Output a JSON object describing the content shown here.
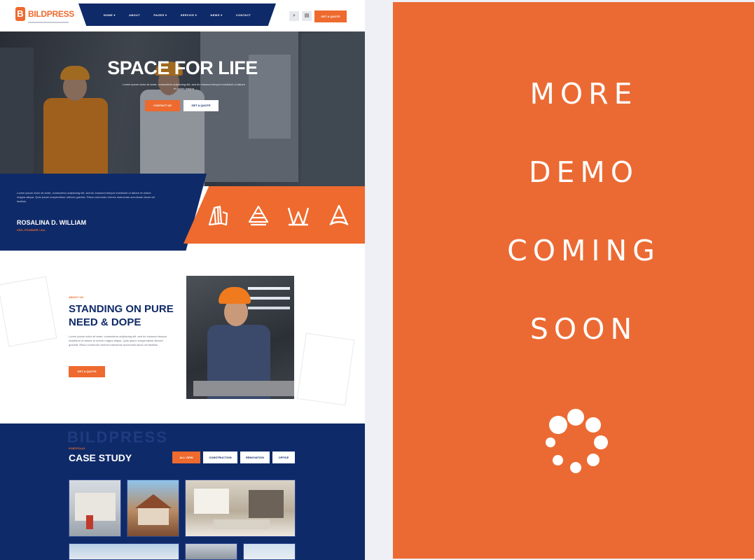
{
  "header": {
    "logo_letter": "B",
    "logo_text": "BILDPRESS",
    "nav": [
      "HOME ▾",
      "ABOUT",
      "PAGES ▾",
      "SERVICE ▾",
      "NEWS ▾",
      "CONTACT"
    ],
    "search_icon": "search-icon",
    "cart_icon": "cart-icon",
    "cta_label": "GET A QUOTE"
  },
  "hero": {
    "title": "SPACE FOR LIFE",
    "text": "Lorem ipsum dolor sit amet, consectetur adipiscing elit, sed do eiusmod tempor incididunt ut labore et dolore magna",
    "btn_primary": "CONTACT US",
    "btn_secondary": "GET A QUOTE"
  },
  "band": {
    "text": "Lorem ipsum dolor sit amet, consectetur adipiscing elit, sed do eiusmod tempor incididunt ut labore et dolore magna aliqua. Quis ipsum suspendisse ultrices gravida. Risus commodo viverra maecenas accumsan lacus vel facilisis.",
    "name": "ROSALINA D. WILLIAM",
    "role": "CEO, FOUNDER / ALL",
    "icons": [
      "building-icon",
      "tower-icon",
      "structure-icon",
      "letter-a-icon"
    ]
  },
  "about": {
    "eyebrow": "ABOUT US",
    "title": "STANDING ON PURE NEED & DOPE",
    "text": "Lorem ipsum dolor sit amet, consectetur adipiscing elit, sed do eiusmod tempor incididunt ut labore et dolore magna aliqua. Quis ipsum suspendisse ultrices gravida. Risus commodo viverra maecenas accumsan lacus vel facilisis.",
    "button": "GET A QUOTE"
  },
  "case_study": {
    "ghost": "BILDPRESS",
    "eyebrow": "PORTFOLIO",
    "title": "CASE STUDY",
    "tabs": [
      "ALL VIEW",
      "CONSTRUCTION",
      "RENOVATION",
      "OFFICE"
    ]
  },
  "promo": {
    "lines": [
      "MORE",
      "DEMO",
      "COMING",
      "SOON"
    ],
    "loader_icon": "loading-spinner-icon",
    "background": "#eb6a33"
  },
  "colors": {
    "brand_orange": "#ee6a2e",
    "brand_navy": "#0f2a68"
  }
}
